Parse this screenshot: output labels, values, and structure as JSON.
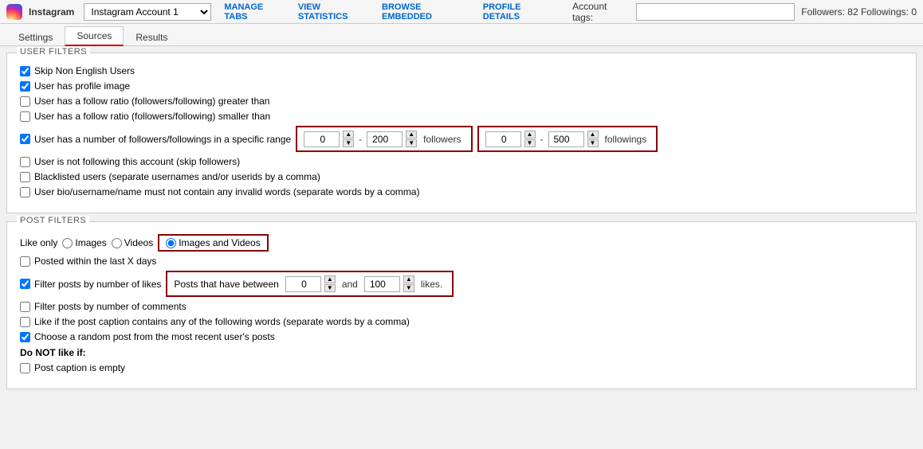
{
  "topbar": {
    "app_name": "Instagram",
    "account_label": "Instagram Account 1",
    "nav": {
      "manage_tabs": "MANAGE TABS",
      "view_statistics": "VIEW STATISTICS",
      "browse_embedded": "BROWSE EMBEDDED",
      "profile_details": "PROFILE DETAILS"
    },
    "account_tags_label": "Account tags:",
    "followers_info": "Followers: 82   Followings: 0"
  },
  "tabs": {
    "settings": "Settings",
    "sources": "Sources",
    "results": "Results"
  },
  "user_filters": {
    "title": "USER FILTERS",
    "skip_non_english": {
      "label": "Skip Non English Users",
      "checked": true
    },
    "has_profile_image": {
      "label": "User has profile image",
      "checked": true
    },
    "follow_ratio_greater": {
      "label": "User has a follow ratio (followers/following) greater than",
      "checked": false
    },
    "follow_ratio_smaller": {
      "label": "User has a follow ratio (followers/following) smaller than",
      "checked": false
    },
    "followers_range": {
      "label": "User has a number of followers/followings in a specific range",
      "checked": true,
      "from_followers": "0",
      "to_followers": "200",
      "followers_label": "followers",
      "from_followings": "0",
      "to_followings": "500",
      "followings_label": "followings"
    },
    "not_following": {
      "label": "User is not following this account (skip followers)",
      "checked": false
    },
    "blacklisted": {
      "label": "Blacklisted users (separate usernames and/or userids by a comma)",
      "checked": false
    },
    "bio_words": {
      "label": "User bio/username/name must not contain any invalid words (separate words by a comma)",
      "checked": false
    }
  },
  "post_filters": {
    "title": "POST FILTERS",
    "like_only_label": "Like only",
    "like_only_options": [
      {
        "label": "Images",
        "value": "images",
        "checked": false
      },
      {
        "label": "Videos",
        "value": "videos",
        "checked": false
      },
      {
        "label": "Images and Videos",
        "value": "images_and_videos",
        "checked": true
      }
    ],
    "posted_within": {
      "label": "Posted within the last X days",
      "checked": false
    },
    "filter_by_likes": {
      "label": "Filter posts by number of likes",
      "checked": true,
      "between_label": "Posts that have between",
      "from_val": "0",
      "and_label": "and",
      "to_val": "100",
      "likes_label": "likes."
    },
    "filter_by_comments": {
      "label": "Filter posts by number of comments",
      "checked": false
    },
    "like_if_caption": {
      "label": "Like if the post caption contains any of the following words (separate words by a comma)",
      "checked": false
    },
    "random_post": {
      "label": "Choose a random post from the most recent user's posts",
      "checked": true
    },
    "do_not_like_label": "Do NOT like if:",
    "post_caption_empty": {
      "label": "Post caption is empty",
      "checked": false
    }
  }
}
